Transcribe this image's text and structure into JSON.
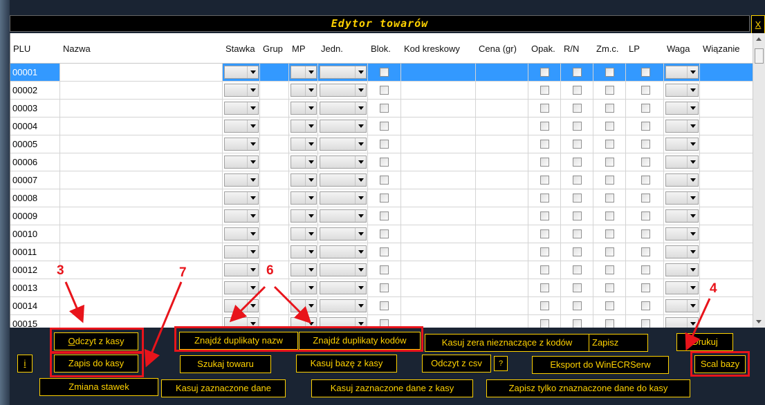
{
  "window": {
    "title": "Edytor towarów",
    "close_label": "X"
  },
  "colors": {
    "accent": "#ffd200",
    "annotation": "#e8141b",
    "selection": "#3399ff"
  },
  "columns": [
    "PLU",
    "Nazwa",
    "Stawka",
    "Grup",
    "MP",
    "Jedn.",
    "Blok.",
    "Kod kreskowy",
    "Cena (gr)",
    "Opak.",
    "R/N",
    "Zm.c.",
    "LP",
    "Waga",
    "Wiązanie"
  ],
  "rows": [
    "00001",
    "00002",
    "00003",
    "00004",
    "00005",
    "00006",
    "00007",
    "00008",
    "00009",
    "00010",
    "00011",
    "00012",
    "00013",
    "00014",
    "00015"
  ],
  "selected_row": "00001",
  "buttons": {
    "info": "i",
    "read_from_register": "Odczyt z kasy",
    "write_to_register": "Zapis do kasy",
    "change_rates": "Zmiana stawek",
    "find_dup_names": "Znajdź duplikaty nazw",
    "find_dup_codes": "Znajdź duplikaty kodów",
    "search_product": "Szukaj towaru",
    "delete_selected": "Kasuj zaznaczone dane",
    "delete_db_from_register": "Kasuj bazę z kasy",
    "read_from_csv": "Odczyt z csv",
    "help": "?",
    "delete_selected_from_register": "Kasuj zaznaczone dane z kasy",
    "delete_nonsignificant_zeros": "Kasuj zera nieznaczące z kodów",
    "save": "Zapisz",
    "export_winecr": "Eksport do WinECRSerw",
    "save_selected_only": "Zapisz tylko znaznaczone dane do kasy",
    "print": "Drukuj",
    "merge_db": "Scal bazy"
  },
  "annotations": [
    "3",
    "7",
    "6",
    "4"
  ],
  "icons": [
    "close-icon",
    "chevron-down-icon",
    "checkbox-icon",
    "scroll-up-icon",
    "scroll-down-icon",
    "arrow-icon"
  ]
}
